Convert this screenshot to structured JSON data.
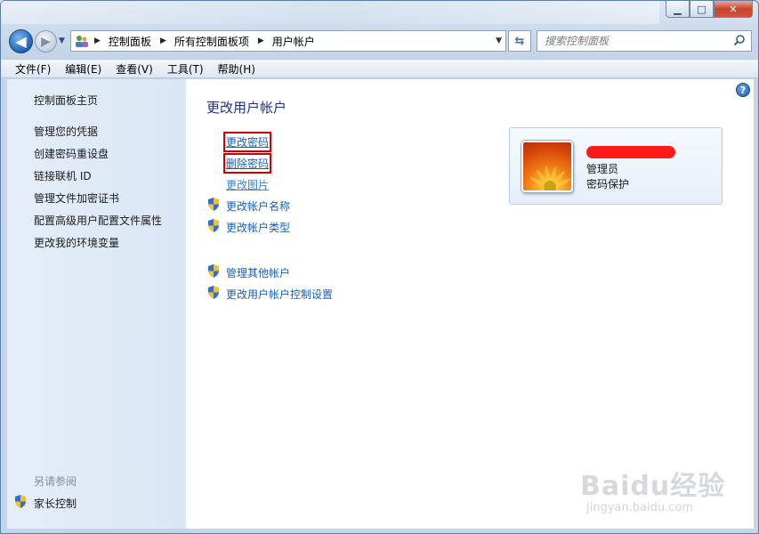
{
  "window": {
    "caption_buttons": [
      "minimize",
      "maximize",
      "close"
    ]
  },
  "address_bar": {
    "crumbs": [
      "控制面板",
      "所有控制面板项",
      "用户帐户"
    ]
  },
  "search": {
    "placeholder": "搜索控制面板"
  },
  "menu": {
    "items": [
      "文件(F)",
      "编辑(E)",
      "查看(V)",
      "工具(T)",
      "帮助(H)"
    ]
  },
  "sidebar": {
    "home": "控制面板主页",
    "links": [
      "管理您的凭据",
      "创建密码重设盘",
      "链接联机 ID",
      "管理文件加密证书",
      "配置高级用户配置文件属性",
      "更改我的环境变量"
    ],
    "see_also": "另请参阅",
    "parental_controls": "家长控制"
  },
  "main": {
    "title": "更改用户帐户",
    "tasks": {
      "change_password": "更改密码",
      "remove_password": "删除密码",
      "change_picture": "更改图片",
      "change_name": "更改帐户名称",
      "change_type": "更改帐户类型",
      "manage_other": "管理其他帐户",
      "uac_settings": "更改用户帐户控制设置"
    }
  },
  "account": {
    "role": "管理员",
    "protection": "密码保护"
  },
  "watermark": {
    "text": "Baidu经验",
    "sub": "jingyan.baidu.com"
  },
  "colors": {
    "link": "#1a5fb4",
    "title": "#1e3287",
    "highlight_box": "#d00000",
    "left_pane": "#dae6f5"
  }
}
